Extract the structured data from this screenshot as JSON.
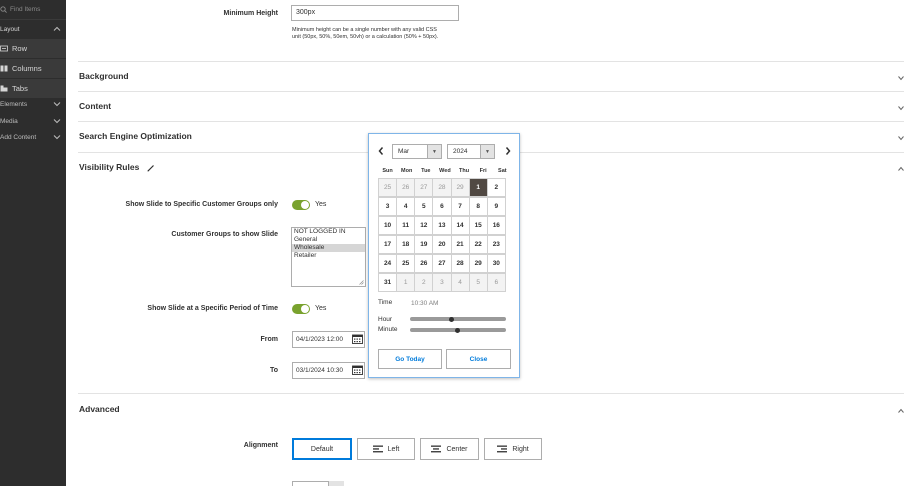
{
  "sidebar": {
    "search_placeholder": "Find Items",
    "sections": {
      "layout": "Layout",
      "elements": "Elements",
      "media": "Media",
      "add_content": "Add Content"
    },
    "layout_items": {
      "row": "Row",
      "columns": "Columns",
      "tabs": "Tabs"
    }
  },
  "min_height": {
    "label": "Minimum Height",
    "value": "300px",
    "note_line1": "Minimum height can be a single number with any valid CSS",
    "note_line2": "unit (50px, 50%, 50em, 50vh) or a calculation (50% + 50px)."
  },
  "sections": {
    "background": "Background",
    "content": "Content",
    "seo": "Search Engine Optimization",
    "visibility": "Visibility Rules",
    "advanced": "Advanced"
  },
  "visibility": {
    "customer_groups_toggle_label": "Show Slide to Specific Customer Groups only",
    "customer_groups_toggle_value": "Yes",
    "customer_groups_label": "Customer Groups to show Slide",
    "customer_group_options": [
      "NOT LOGGED IN",
      "General",
      "Wholesale",
      "Retailer"
    ],
    "period_toggle_label": "Show Slide at a Specific Period of Time",
    "period_toggle_value": "Yes",
    "from_label": "From",
    "from_value": "04/1/2023 12:00",
    "to_label": "To",
    "to_value": "03/1/2024 10:30"
  },
  "advanced": {
    "alignment_label": "Alignment",
    "alignment_options": {
      "default": "Default",
      "left": "Left",
      "center": "Center",
      "right": "Right"
    }
  },
  "datepicker": {
    "month": "Mar",
    "year": "2024",
    "weekdays": [
      "Sun",
      "Mon",
      "Tue",
      "Wed",
      "Thu",
      "Fri",
      "Sat"
    ],
    "weeks": [
      [
        "25",
        "26",
        "27",
        "28",
        "29",
        "1",
        "2"
      ],
      [
        "3",
        "4",
        "5",
        "6",
        "7",
        "8",
        "9"
      ],
      [
        "10",
        "11",
        "12",
        "13",
        "14",
        "15",
        "16"
      ],
      [
        "17",
        "18",
        "19",
        "20",
        "21",
        "22",
        "23"
      ],
      [
        "24",
        "25",
        "26",
        "27",
        "28",
        "29",
        "30"
      ],
      [
        "31",
        "1",
        "2",
        "3",
        "4",
        "5",
        "6"
      ]
    ],
    "time_label": "Time",
    "time_value": "10:30 AM",
    "hour_label": "Hour",
    "minute_label": "Minute",
    "go_today": "Go Today",
    "close": "Close"
  },
  "colors": {
    "sidebar_bg": "#2d2d2d",
    "toggle_on": "#79a22e",
    "accent_blue": "#007bdb",
    "today_bg": "#514943"
  }
}
